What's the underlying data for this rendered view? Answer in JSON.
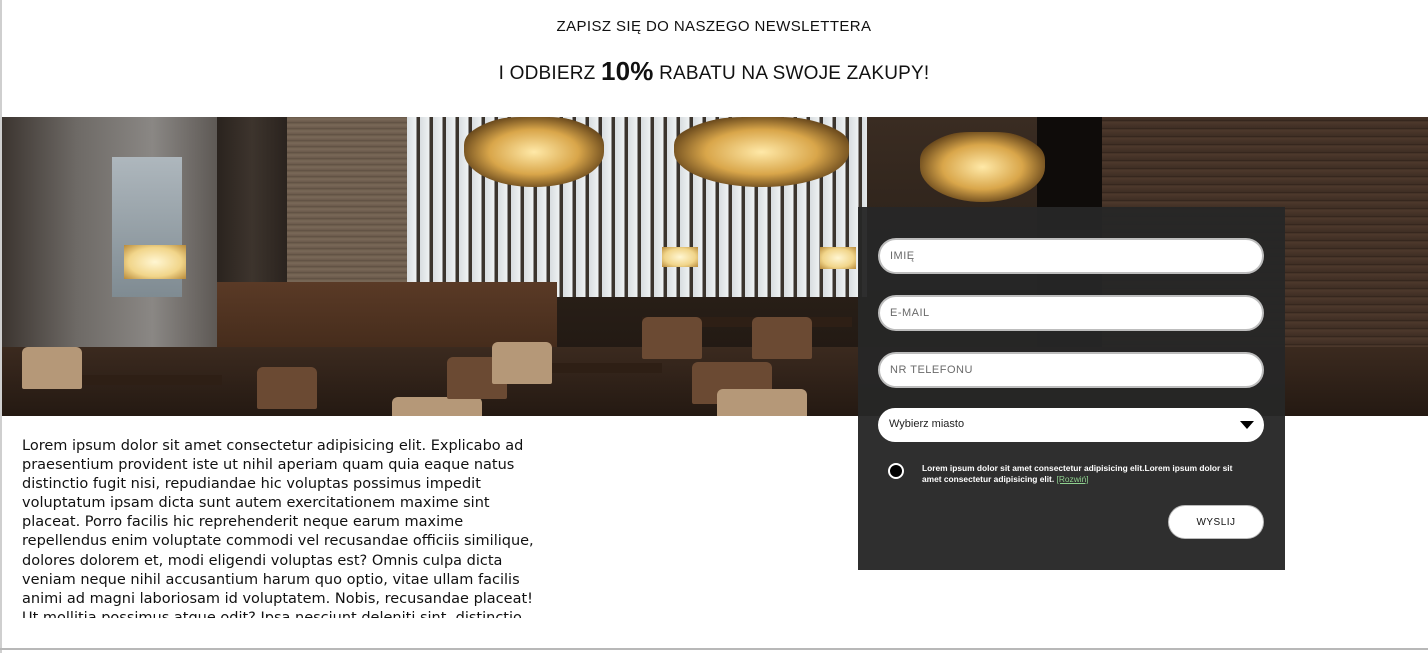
{
  "header": {
    "title": "ZAPISZ SIĘ DO NASZEGO NEWSLETTERA",
    "subtitle_prefix": "I ODBIERZ",
    "subtitle_discount": "10%",
    "subtitle_suffix": "RABATU NA SWOJE ZAKUPY!"
  },
  "hero": {
    "icon": "restaurant-photo"
  },
  "content": {
    "lorem": "Lorem ipsum dolor sit amet consectetur adipisicing elit. Explicabo ad praesentium provident iste ut nihil aperiam quam quia eaque natus distinctio fugit nisi, repudiandae hic voluptas possimus impedit voluptatum ipsam dicta sunt autem exercitationem maxime sint placeat. Porro facilis hic reprehenderit neque earum maxime repellendus enim voluptate commodi vel recusandae officiis similique, dolores dolorem et, modi eligendi voluptas est? Omnis culpa dicta veniam neque nihil accusantium harum quo optio, vitae ullam facilis animi ad magni laboriosam id voluptatem. Nobis, recusandae placeat! Ut mollitia possimus atque odit? Ipsa nesciunt deleniti sint, distinctio impedit laborum error vitae corporis necessitatibus alias."
  },
  "form": {
    "name_placeholder": "IMIĘ",
    "email_placeholder": "E-MAIL",
    "phone_placeholder": "NR TELEFONU",
    "city_select": "Wybierz miasto",
    "consent_text": "Lorem ipsum dolor sit amet consectetur adipisicing elit.Lorem ipsum dolor sit amet consectetur adipisicing elit.",
    "consent_more": "[Rozwiń]",
    "submit_label": "WYSLIJ"
  },
  "colors": {
    "panel": "#262626",
    "consent_link": "#8fd18f"
  }
}
